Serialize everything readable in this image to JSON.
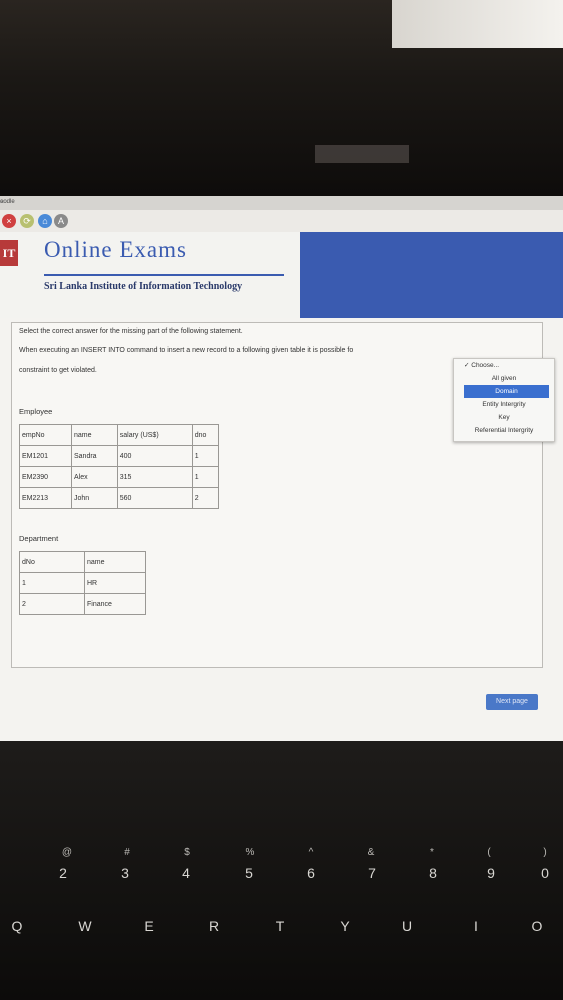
{
  "tab": {
    "label": "oodle"
  },
  "header": {
    "logo_text": "IT",
    "title": "Online Exams",
    "subtitle": "Sri Lanka Institute of Information Technology"
  },
  "question": {
    "intro": "Select the correct answer for the missing part of the following statement.",
    "line1": "When executing an INSERT INTO command to insert a new record to a following given table it is possible fo",
    "line2": "constraint to get violated."
  },
  "dropdown": {
    "selected": "✓ Choose...",
    "options": [
      "All given",
      "Domain",
      "Entity Intergrity",
      "Key",
      "Referential Intergrity"
    ]
  },
  "employee": {
    "title": "Employee",
    "headers": [
      "empNo",
      "name",
      "salary (US$)",
      "dno"
    ],
    "rows": [
      [
        "EM1201",
        "Sandra",
        "400",
        "1"
      ],
      [
        "EM2390",
        "Alex",
        "315",
        "1"
      ],
      [
        "EM2213",
        "John",
        "560",
        "2"
      ]
    ]
  },
  "department": {
    "title": "Department",
    "headers": [
      "dNo",
      "name"
    ],
    "rows": [
      [
        "1",
        "HR"
      ],
      [
        "2",
        "Finance"
      ]
    ]
  },
  "nav": {
    "next_label": "Next page"
  },
  "keyboard": {
    "num_shift": [
      "@",
      "#",
      "$",
      "%",
      "^",
      "&",
      "*",
      "(",
      ")"
    ],
    "num": [
      "2",
      "3",
      "4",
      "5",
      "6",
      "7",
      "8",
      "9",
      "0"
    ],
    "row_q": [
      "Q",
      "W",
      "E",
      "R",
      "T",
      "Y",
      "U",
      "I",
      "O"
    ]
  }
}
